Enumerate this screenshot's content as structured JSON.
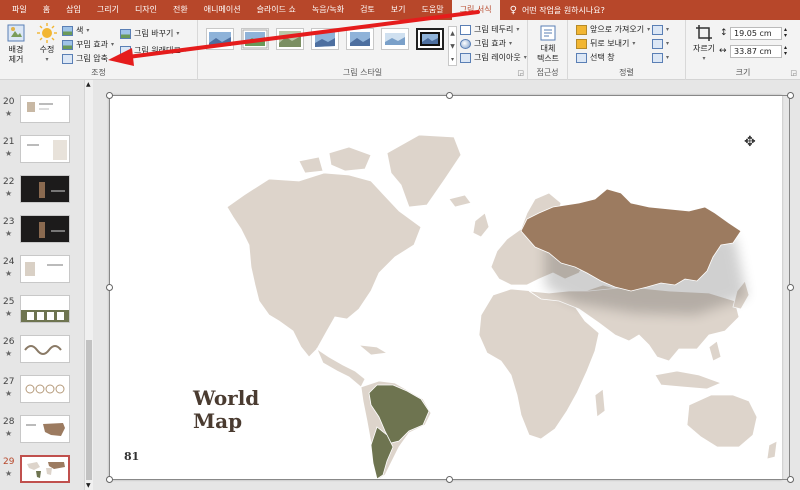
{
  "tabs": [
    "파일",
    "홈",
    "삽입",
    "그리기",
    "디자인",
    "전환",
    "애니메이션",
    "슬라이드 쇼",
    "녹음/녹화",
    "검토",
    "보기",
    "도움말",
    "그림 서식"
  ],
  "active_tab": "그림 서식",
  "tell_me": "어떤 작업을 원하시나요?",
  "adjust": {
    "remove_bg": "배경\n제거",
    "corrections": "수정",
    "color": "색",
    "artistic": "꾸밈 효과",
    "compress": "그림 압축",
    "change": "그림 바꾸기",
    "reset": "그림 원래대로",
    "label": "조정"
  },
  "styles": {
    "label": "그림 스타일",
    "border": "그림 테두리",
    "effects": "그림 효과",
    "layout": "그림 레이아웃"
  },
  "accessibility": {
    "alt_text": "대체\n텍스트",
    "label": "접근성"
  },
  "arrange": {
    "forward": "앞으로 가져오기",
    "backward": "뒤로 보내기",
    "pane": "선택 창",
    "label": "정렬"
  },
  "size": {
    "crop": "자르기",
    "height": "19.05 cm",
    "width": "33.87 cm",
    "label": "크기"
  },
  "thumbnails": [
    {
      "num": "20",
      "star": "★"
    },
    {
      "num": "21",
      "star": "★"
    },
    {
      "num": "22",
      "star": "★"
    },
    {
      "num": "23",
      "star": "★"
    },
    {
      "num": "24",
      "star": "★"
    },
    {
      "num": "25",
      "star": "★"
    },
    {
      "num": "26",
      "star": "★"
    },
    {
      "num": "27",
      "star": "★"
    },
    {
      "num": "28",
      "star": "★"
    },
    {
      "num": "29",
      "star": "★"
    }
  ],
  "slide": {
    "title_line1": "World",
    "title_line2": "Map",
    "page_number": "81"
  },
  "colors": {
    "ribbon_accent": "#b7472a",
    "land": "#ddd4cb",
    "russia": "#9c7b60",
    "brazil": "#6e7450",
    "arrow": "#e51c1c"
  }
}
